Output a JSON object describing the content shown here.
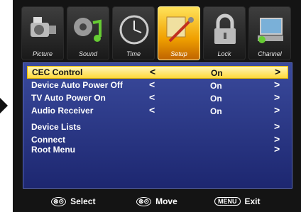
{
  "tabs": [
    {
      "label": "Picture",
      "icon": "camera-icon",
      "active": false
    },
    {
      "label": "Sound",
      "icon": "music-note-icon",
      "active": false
    },
    {
      "label": "Time",
      "icon": "clock-icon",
      "active": false
    },
    {
      "label": "Setup",
      "icon": "tools-icon",
      "active": true
    },
    {
      "label": "Lock",
      "icon": "padlock-icon",
      "active": false
    },
    {
      "label": "Channel",
      "icon": "computer-icon",
      "active": false
    }
  ],
  "menu": {
    "items": [
      {
        "label": "CEC Control",
        "value": "On",
        "selected": true
      },
      {
        "label": "Device Auto Power Off",
        "value": "On"
      },
      {
        "label": "TV Auto Power On",
        "value": "On"
      },
      {
        "label": "Audio Receiver",
        "value": "On"
      },
      {
        "label": "Device Lists"
      },
      {
        "label": "Connect"
      },
      {
        "label": "Root Menu"
      }
    ],
    "left_arrow": "<",
    "right_arrow": ">"
  },
  "footer": {
    "select_key": "⊗⊙",
    "select_label": "Select",
    "move_key": "⊗⊙",
    "move_label": "Move",
    "menu_key": "MENU",
    "menu_label": "Exit"
  },
  "colors": {
    "panel": "#2a3585",
    "highlight": "#ffe066",
    "active_tab": "#f5b800"
  }
}
